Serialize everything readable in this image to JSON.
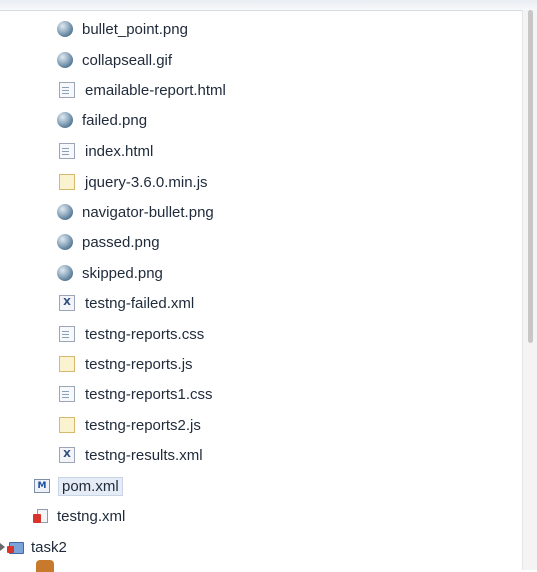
{
  "tree": {
    "items": [
      {
        "label": "bullet_point.png",
        "icon": "image-file-icon"
      },
      {
        "label": "collapseall.gif",
        "icon": "image-file-icon"
      },
      {
        "label": "emailable-report.html",
        "icon": "html-file-icon"
      },
      {
        "label": "failed.png",
        "icon": "image-file-icon"
      },
      {
        "label": "index.html",
        "icon": "html-file-icon"
      },
      {
        "label": "jquery-3.6.0.min.js",
        "icon": "js-file-icon"
      },
      {
        "label": "navigator-bullet.png",
        "icon": "image-file-icon"
      },
      {
        "label": "passed.png",
        "icon": "image-file-icon"
      },
      {
        "label": "skipped.png",
        "icon": "image-file-icon"
      },
      {
        "label": "testng-failed.xml",
        "icon": "xml-file-icon"
      },
      {
        "label": "testng-reports.css",
        "icon": "css-file-icon"
      },
      {
        "label": "testng-reports.js",
        "icon": "js-file-icon"
      },
      {
        "label": "testng-reports1.css",
        "icon": "css-file-icon"
      },
      {
        "label": "testng-reports2.js",
        "icon": "js-file-icon"
      },
      {
        "label": "testng-results.xml",
        "icon": "xml-file-icon"
      },
      {
        "label": "pom.xml",
        "icon": "maven-pom-icon"
      },
      {
        "label": "testng.xml",
        "icon": "testng-file-icon"
      },
      {
        "label": "task2",
        "icon": "project-folder-icon"
      }
    ]
  }
}
